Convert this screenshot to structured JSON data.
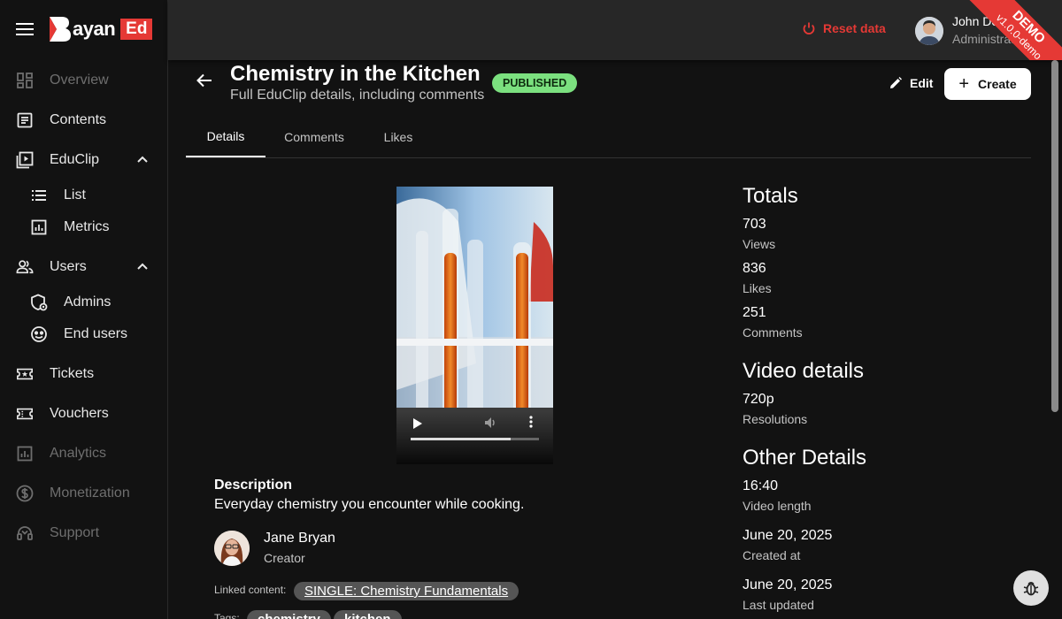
{
  "brand": {
    "name": "ayan",
    "suffix": "Ed"
  },
  "sidebar": {
    "items": [
      {
        "label": "Overview",
        "icon": "dashboard-icon",
        "disabled": true
      },
      {
        "label": "Contents",
        "icon": "article-icon",
        "disabled": false
      },
      {
        "label": "EduClip",
        "icon": "video-library-icon",
        "disabled": false,
        "expanded": true,
        "children": [
          {
            "label": "List",
            "icon": "list-icon"
          },
          {
            "label": "Metrics",
            "icon": "bar-chart-icon"
          }
        ]
      },
      {
        "label": "Users",
        "icon": "people-icon",
        "disabled": false,
        "expanded": true,
        "children": [
          {
            "label": "Admins",
            "icon": "admin-shield-icon"
          },
          {
            "label": "End users",
            "icon": "face-icon"
          }
        ]
      },
      {
        "label": "Tickets",
        "icon": "ticket-icon",
        "disabled": false
      },
      {
        "label": "Vouchers",
        "icon": "voucher-icon",
        "disabled": false
      },
      {
        "label": "Analytics",
        "icon": "analytics-icon",
        "disabled": true
      },
      {
        "label": "Monetization",
        "icon": "dollar-icon",
        "disabled": true
      },
      {
        "label": "Support",
        "icon": "headset-icon",
        "disabled": true
      }
    ]
  },
  "topbar": {
    "reset_label": "Reset data",
    "user_name": "John Doe",
    "user_role": "Administrator",
    "ribbon_title": "DEMO",
    "ribbon_version": "v1.0.0-demo"
  },
  "page": {
    "title": "Chemistry in the Kitchen",
    "subtitle": "Full EduClip details, including comments",
    "status": "PUBLISHED",
    "edit_label": "Edit",
    "create_label": "Create"
  },
  "tabs": [
    "Details",
    "Comments",
    "Likes"
  ],
  "video": {
    "progress": 0.78
  },
  "details": {
    "description_label": "Description",
    "description": "Everyday chemistry you encounter while cooking.",
    "creator_name": "Jane Bryan",
    "creator_role": "Creator",
    "linked_label": "Linked content:",
    "linked_value": "SINGLE: Chemistry Fundamentals",
    "tags_label": "Tags:",
    "tags": [
      "chemistry",
      "kitchen"
    ]
  },
  "totals": {
    "heading": "Totals",
    "views": "703",
    "views_label": "Views",
    "likes": "836",
    "likes_label": "Likes",
    "comments": "251",
    "comments_label": "Comments"
  },
  "video_details": {
    "heading": "Video details",
    "resolution": "720p",
    "resolution_label": "Resolutions"
  },
  "other_details": {
    "heading": "Other Details",
    "length": "16:40",
    "length_label": "Video length",
    "created": "June 20, 2025",
    "created_label": "Created at",
    "updated": "June 20, 2025",
    "updated_label": "Last updated"
  },
  "colors": {
    "accent": "#e53935",
    "published": "#7be07f",
    "background": "#121212",
    "topbar": "#272727"
  }
}
